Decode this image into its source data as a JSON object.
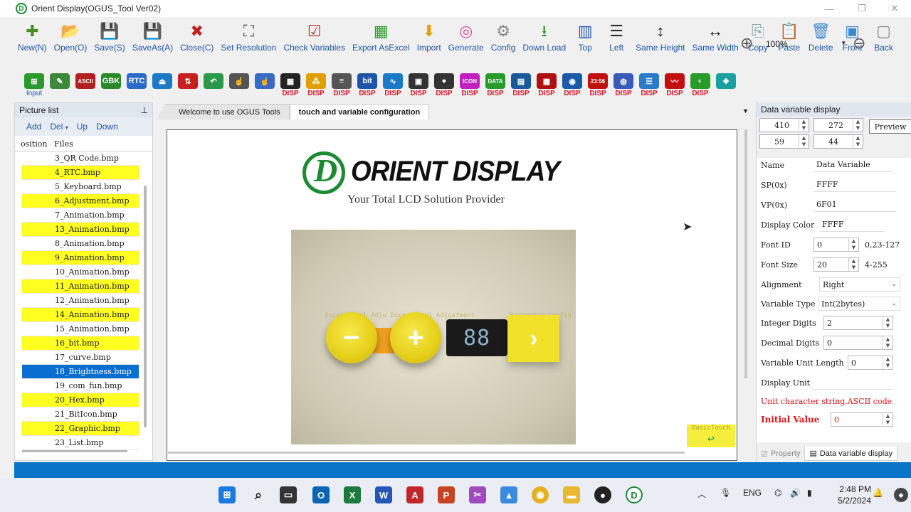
{
  "window": {
    "title": "Orient Display(OGUS_Tool Ver02)"
  },
  "toolbar_main": [
    {
      "label": "New(N)",
      "icon": "new-icon"
    },
    {
      "label": "Open(O)",
      "icon": "open-icon"
    },
    {
      "label": "Save(S)",
      "icon": "save-icon"
    },
    {
      "label": "SaveAs(A)",
      "icon": "saveas-icon"
    },
    {
      "label": "Close(C)",
      "icon": "close-file-icon"
    },
    {
      "label": "Set Resolution",
      "icon": "resolution-icon"
    },
    {
      "label": "Check Variables",
      "icon": "check-icon"
    },
    {
      "label": "Export AsExcel",
      "icon": "excel-icon"
    },
    {
      "label": "Import",
      "icon": "import-icon"
    },
    {
      "label": "Generate",
      "icon": "generate-icon"
    },
    {
      "label": "Config",
      "icon": "config-icon"
    },
    {
      "label": "Down Load",
      "icon": "download-icon"
    },
    {
      "label": "Top",
      "icon": "align-top-icon"
    },
    {
      "label": "Left",
      "icon": "align-left-icon"
    },
    {
      "label": "Same Height",
      "icon": "same-height-icon"
    },
    {
      "label": "Same Width",
      "icon": "same-width-icon"
    },
    {
      "label": "Copy",
      "icon": "copy-icon"
    },
    {
      "label": "Paste",
      "icon": "paste-icon"
    },
    {
      "label": "Delete",
      "icon": "delete-icon"
    },
    {
      "label": "Front",
      "icon": "front-icon"
    },
    {
      "label": "Back",
      "icon": "back-icon"
    }
  ],
  "zoom": {
    "value": "100%"
  },
  "toolbar_widgets": [
    {
      "glyph": "⊞",
      "label": "Input",
      "color": "#2a9a2a"
    },
    {
      "glyph": "✎",
      "label": "",
      "color": "#3a8a3a"
    },
    {
      "glyph": "ASCII",
      "label": "",
      "color": "#b02020"
    },
    {
      "glyph": "GBK",
      "label": "",
      "color": "#2a8a2a"
    },
    {
      "glyph": "RTC",
      "label": "",
      "color": "#2a6ac8"
    },
    {
      "glyph": "⏏",
      "label": "",
      "color": "#1a7ac8"
    },
    {
      "glyph": "⇅",
      "label": "",
      "color": "#c82020"
    },
    {
      "glyph": "↶",
      "label": "",
      "color": "#2a9a4a"
    },
    {
      "glyph": "☝",
      "label": "",
      "color": "#555"
    },
    {
      "glyph": "☝",
      "label": "",
      "color": "#3a6ac8"
    },
    {
      "glyph": "▦",
      "label": "DISP",
      "color": "#222"
    },
    {
      "glyph": "⁂",
      "label": "DISP",
      "color": "#e0a000"
    },
    {
      "glyph": "≡",
      "label": "DISP",
      "color": "#555"
    },
    {
      "glyph": "bit",
      "label": "DISP",
      "color": "#1f55a7"
    },
    {
      "glyph": "∿",
      "label": "DISP",
      "color": "#1a7ac8"
    },
    {
      "glyph": "▣",
      "label": "DISP",
      "color": "#333"
    },
    {
      "glyph": "●",
      "label": "DISP",
      "color": "#333"
    },
    {
      "glyph": "ICON",
      "label": "DISP",
      "color": "#c020c0"
    },
    {
      "glyph": "DATA",
      "label": "DISP",
      "color": "#2a9a2a"
    },
    {
      "glyph": "▤",
      "label": "DISP",
      "color": "#1a5a9a"
    },
    {
      "glyph": "▩",
      "label": "DISP",
      "color": "#b01010"
    },
    {
      "glyph": "◉",
      "label": "DISP",
      "color": "#1a5aa8"
    },
    {
      "glyph": "23:56",
      "label": "DISP",
      "color": "#c01010"
    },
    {
      "glyph": "◍",
      "label": "DISP",
      "color": "#3a5ab8"
    },
    {
      "glyph": "☰",
      "label": "DISP",
      "color": "#2a7ac8"
    },
    {
      "glyph": "〰",
      "label": "DISP",
      "color": "#c01010"
    },
    {
      "glyph": "◐",
      "label": "DISP",
      "color": "#2a9a2a"
    },
    {
      "glyph": "❖",
      "label": "",
      "color": "#1aa0a0"
    }
  ],
  "picture_list": {
    "title": "Picture list",
    "pin": "⊥",
    "actions": {
      "add": "Add",
      "del": "Del",
      "up": "Up",
      "down": "Down"
    },
    "columns": {
      "position": "osition",
      "files": "Files"
    },
    "files": [
      {
        "name": "3_QR Code.bmp",
        "state": "plain"
      },
      {
        "name": "4_RTC.bmp",
        "state": "hl"
      },
      {
        "name": "5_Keyboard.bmp",
        "state": "plain"
      },
      {
        "name": "6_Adjustment.bmp",
        "state": "hl"
      },
      {
        "name": "7_Animation.bmp",
        "state": "plain"
      },
      {
        "name": "13_Animation.bmp",
        "state": "hl"
      },
      {
        "name": "8_Animation.bmp",
        "state": "plain"
      },
      {
        "name": "9_Animation.bmp",
        "state": "hl"
      },
      {
        "name": "10_Animation.bmp",
        "state": "plain"
      },
      {
        "name": "11_Animation.bmp",
        "state": "hl"
      },
      {
        "name": "12_Animation.bmp",
        "state": "plain"
      },
      {
        "name": "14_Animation.bmp",
        "state": "hl"
      },
      {
        "name": "15_Animation.bmp",
        "state": "plain"
      },
      {
        "name": "16_bit.bmp",
        "state": "hl"
      },
      {
        "name": "17_curve.bmp",
        "state": "plain"
      },
      {
        "name": "18_Brightness.bmp",
        "state": "sel"
      },
      {
        "name": "19_com_fun.bmp",
        "state": "plain"
      },
      {
        "name": "20_Hex.bmp",
        "state": "hl"
      },
      {
        "name": "21_BitIcon.bmp",
        "state": "plain"
      },
      {
        "name": "22_Graphic.bmp",
        "state": "hl"
      },
      {
        "name": "23_List.bmp",
        "state": "plain"
      }
    ]
  },
  "tabs": [
    {
      "label": "Welcome to use OGUS Tools"
    },
    {
      "label": "touch and variable configuration"
    }
  ],
  "canvas": {
    "logo_text": "ORIENT DISPLAY",
    "logo_letter": "D",
    "tagline": "Your Total LCD Solution Provider",
    "screen": {
      "label_minus": "Incremental Adju",
      "label_plus": "Incremental Adjustment",
      "label_next": "Parameter Config",
      "minus": "−",
      "plus": "+",
      "counter": "88",
      "next": "›"
    },
    "basic_touch": "BasicTouch"
  },
  "right_panel": {
    "title": "Data variable display",
    "x": "410",
    "y": "272",
    "w": "59",
    "h": "44",
    "preview": "Preview",
    "props": {
      "name_label": "Name",
      "name_value": "Data Variable",
      "sp_label": "SP(0x)",
      "sp_value": "FFFF",
      "vp_label": "VP(0x)",
      "vp_value": "6F01",
      "color_label": "Display Color",
      "color_value": "FFFF",
      "fontid_label": "Font ID",
      "fontid_value": "0",
      "fontid_hint": "0,23-127",
      "fontsize_label": "Font Size",
      "fontsize_value": "20",
      "fontsize_hint": "4-255",
      "align_label": "Alignment",
      "align_value": "Right",
      "vtype_label": "Variable Type",
      "vtype_value": "Int(2bytes)",
      "intd_label": "Integer Digits",
      "intd_value": "2",
      "decd_label": "Decimal Digits",
      "decd_value": "0",
      "vlen_label": "Variable Unit Length",
      "vlen_value": "0",
      "unit_label": "Display Unit",
      "unit_value": "",
      "unit_hint": "Unit character string,ASCII code",
      "init_label": "Initial Value",
      "init_value": "0"
    },
    "bottom_tabs": {
      "property": "Property",
      "data": "Data variable display"
    }
  },
  "taskbar": {
    "lang": "ENG",
    "time": "2:48 PM",
    "date": "5/2/2024"
  }
}
